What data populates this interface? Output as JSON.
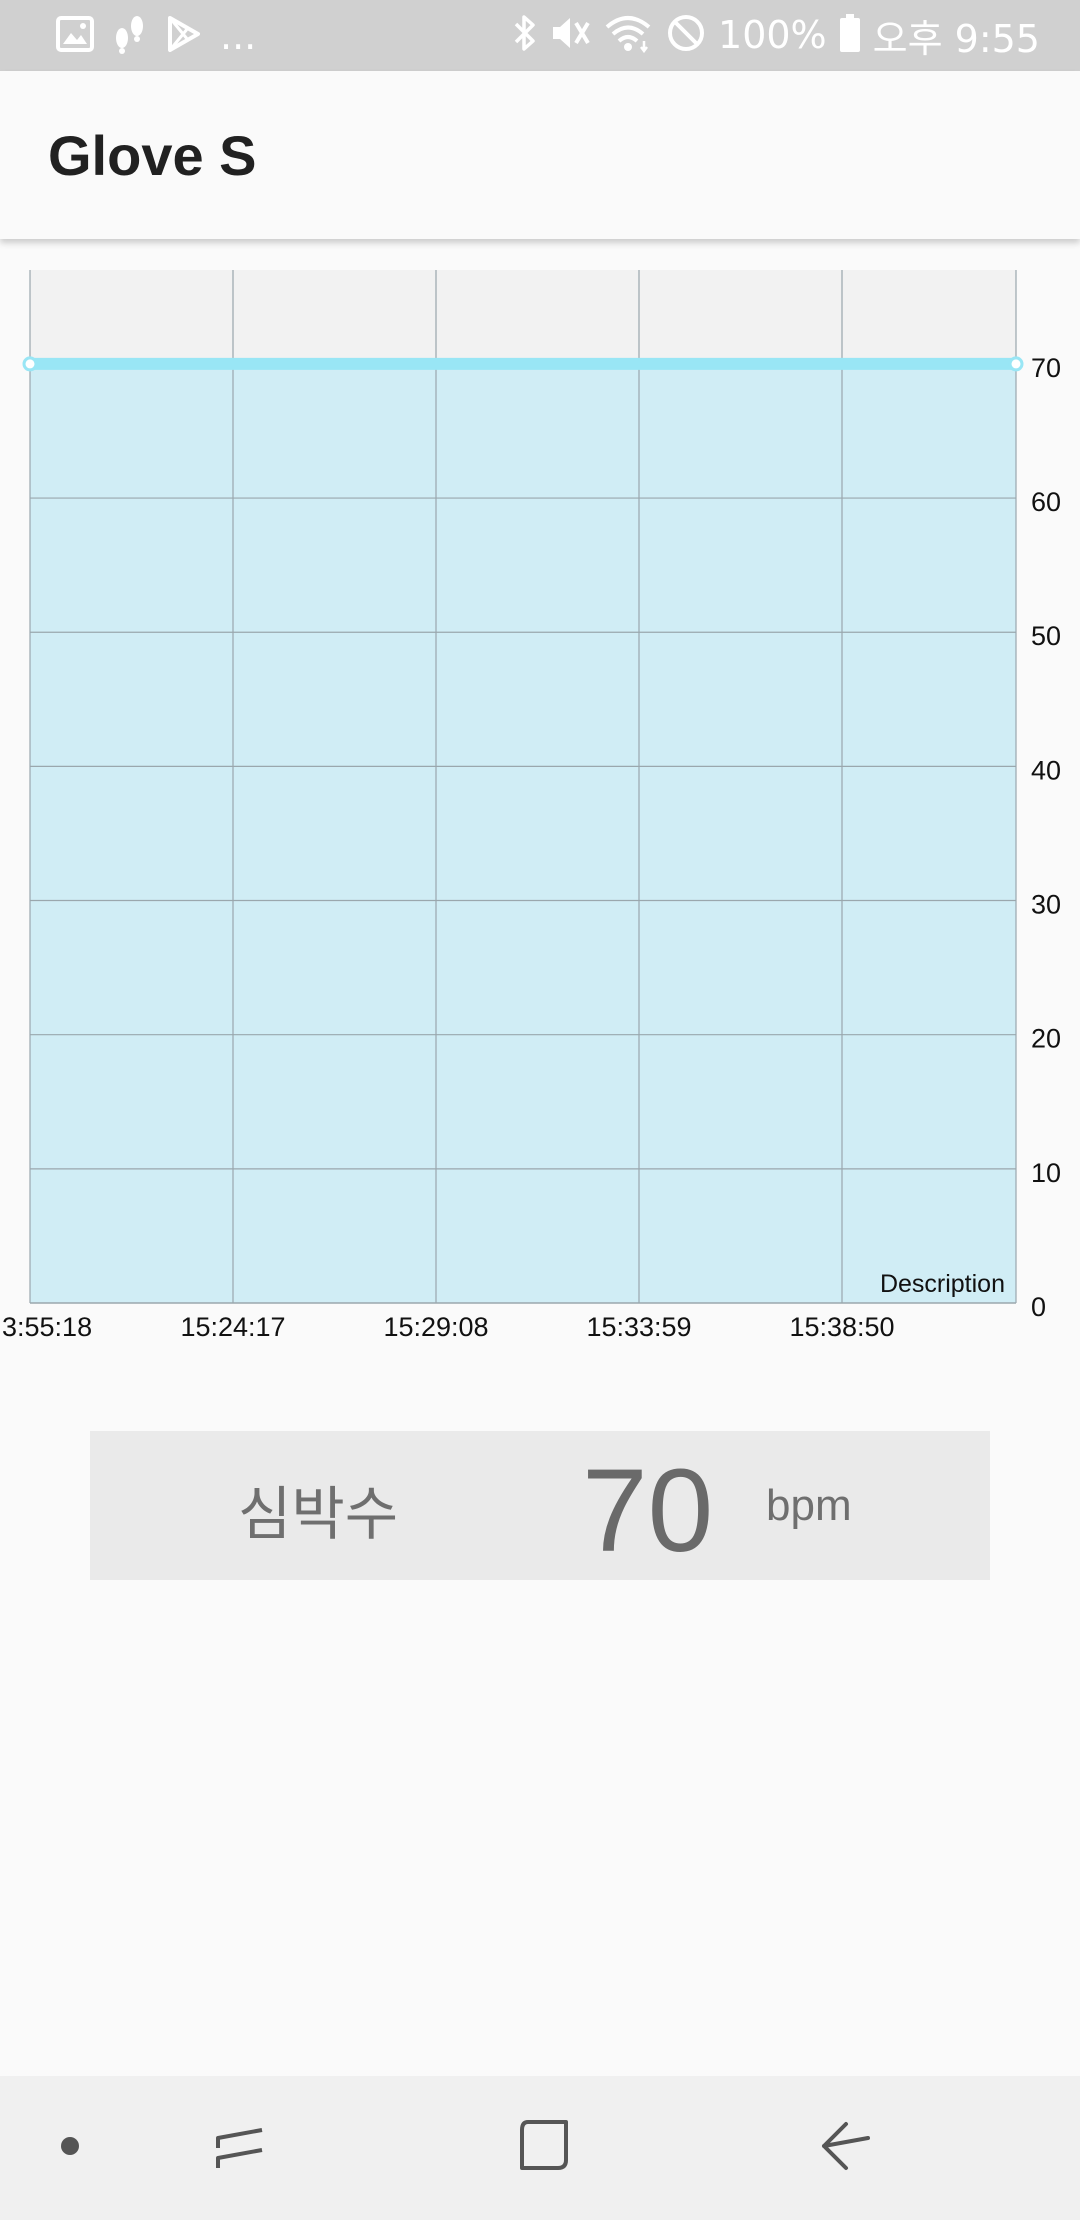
{
  "status_bar": {
    "notification_icons": [
      "image-icon",
      "footprints-icon",
      "play-store-icon"
    ],
    "overflow": "...",
    "system_icons": [
      "bluetooth-icon",
      "mute-icon",
      "wifi-icon",
      "do-not-disturb-icon"
    ],
    "battery": "100%",
    "time": "오후 9:55",
    "icon_color": "#ffffff",
    "background": "#d0d0d0"
  },
  "app_bar": {
    "title": "Glove S"
  },
  "chart_data": {
    "type": "area",
    "x_tick_labels": [
      "3:55:18",
      "15:24:17",
      "15:29:08",
      "15:33:59",
      "15:38:50"
    ],
    "series": [
      {
        "values": [
          70,
          70,
          70,
          70,
          70,
          70
        ],
        "color": "#99e6f5",
        "fill": "#d0edf5"
      }
    ],
    "y_tick_labels": [
      "70",
      "60",
      "50",
      "40",
      "30",
      "20",
      "10",
      "0"
    ],
    "ylim": [
      0,
      77
    ],
    "y_axis_position": "right",
    "grid": true,
    "description": "Description"
  },
  "heart_rate": {
    "label": "심박수",
    "value": "70",
    "unit": "bpm"
  },
  "nav_bar": {
    "buttons": [
      "dot-icon",
      "recent-apps-icon",
      "home-icon",
      "back-icon"
    ]
  }
}
